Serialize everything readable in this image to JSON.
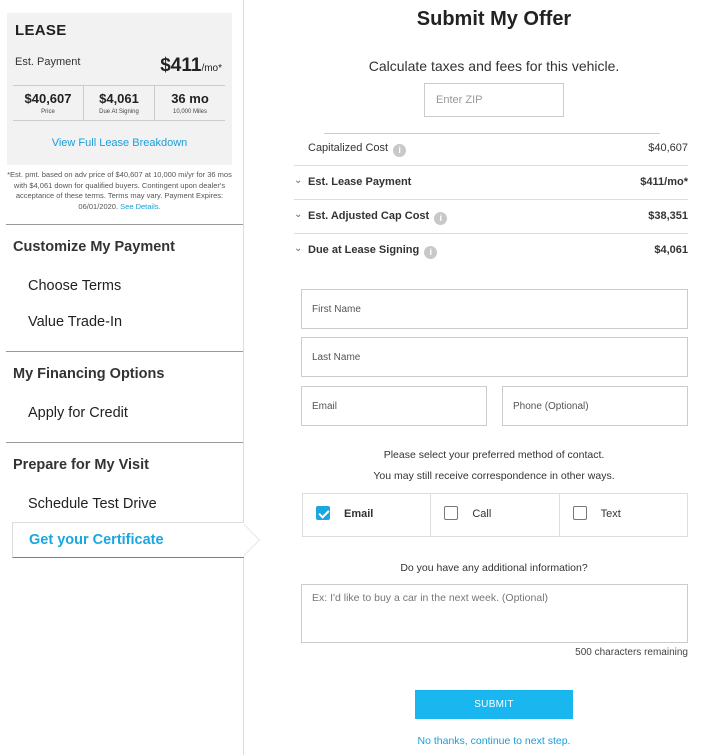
{
  "lease": {
    "title": "LEASE",
    "est_payment_label": "Est. Payment",
    "est_payment_value": "$411",
    "est_payment_unit": "/mo*",
    "stats": [
      {
        "value": "$40,607",
        "sub": "Price"
      },
      {
        "value": "$4,061",
        "sub": "Due At Signing"
      },
      {
        "value": "36 mo",
        "sub": "10,000 Miles"
      }
    ],
    "breakdown_link": "View Full Lease Breakdown",
    "disclaimer": "*Est. pmt. based on adv price of $40,607 at 10,000 mi/yr for 36 mos with $4,061 down for qualified buyers. Contingent upon dealer's acceptance of these terms. Terms may vary. Payment Expires: 06/01/2020.",
    "disclaimer_link": "See Details."
  },
  "nav": {
    "section1": "Customize My Payment",
    "choose_terms": "Choose Terms",
    "value_trade": "Value Trade-In",
    "section2": "My Financing Options",
    "apply_credit": "Apply for Credit",
    "section3": "Prepare for My Visit",
    "schedule": "Schedule Test Drive",
    "certificate": "Get your Certificate"
  },
  "main": {
    "title": "Submit My Offer",
    "subtitle": "Calculate taxes and fees for this vehicle.",
    "zip_placeholder": "Enter ZIP",
    "costs": [
      {
        "label": "Capitalized Cost",
        "value": "$40,607"
      },
      {
        "label": "Est. Lease Payment",
        "value": "$411/mo*"
      },
      {
        "label": "Est. Adjusted Cap Cost",
        "value": "$38,351"
      },
      {
        "label": "Due at Lease Signing",
        "value": "$4,061"
      }
    ],
    "first_name": "First Name",
    "last_name": "Last Name",
    "email": "Email",
    "phone": "Phone (Optional)",
    "contact_note1": "Please select your preferred method of contact.",
    "contact_note2": "You may still receive correspondence in other ways.",
    "contact_options": [
      {
        "label": "Email",
        "checked": true
      },
      {
        "label": "Call",
        "checked": false
      },
      {
        "label": "Text",
        "checked": false
      }
    ],
    "additional_q": "Do you have any additional information?",
    "additional_placeholder": "Ex: I'd like to buy a car in the next week. (Optional)",
    "remaining": "500 characters remaining",
    "submit": "SUBMIT",
    "skip": "No thanks, continue to next step."
  },
  "colors": {
    "accent": "#1aa7e0",
    "button": "#1ab6f0"
  }
}
